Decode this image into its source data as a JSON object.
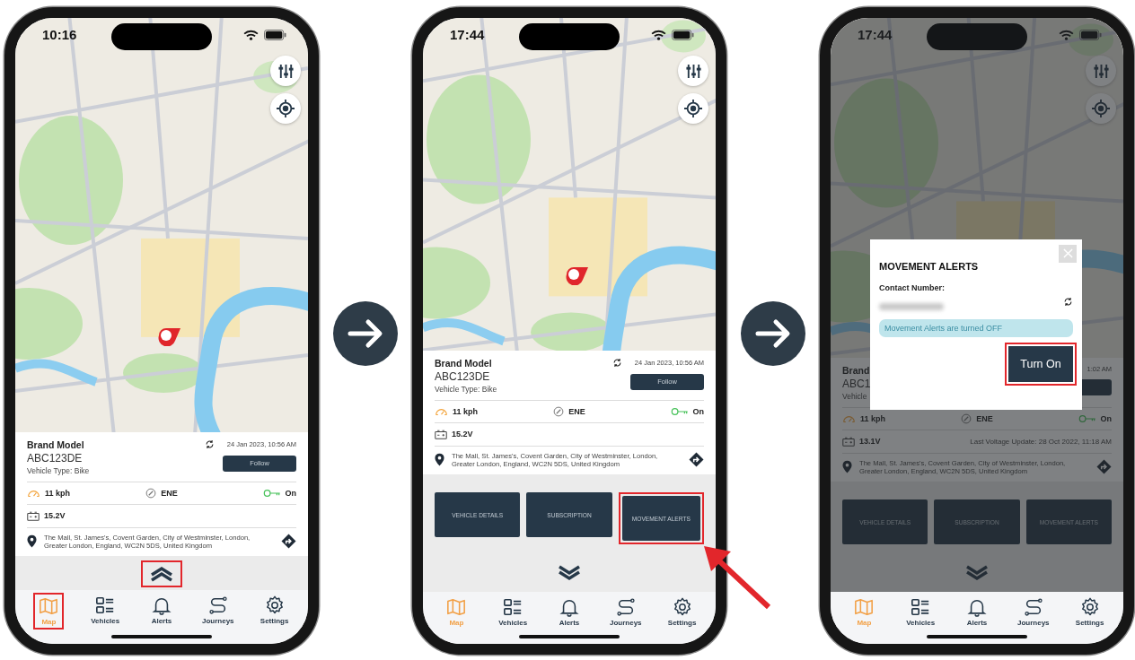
{
  "screens": [
    {
      "status_time": "10:16",
      "dimmed": false,
      "card": {
        "title": "Brand Model",
        "plate": "ABC123DE",
        "vehicle_type": "Vehicle Type: Bike",
        "timestamp": "24 Jan 2023, 10:56 AM",
        "follow_label": "Follow",
        "speed": "11 kph",
        "heading": "ENE",
        "ignition": "On",
        "voltage": "15.2V",
        "address": "The Mall, St. James's, Covent Garden, City of Westminster, London, Greater London, England, WC2N 5DS, United Kingdom"
      },
      "drawer": {
        "expanded": false,
        "highlighted": true
      },
      "tabs": [
        {
          "label": "Map",
          "selected": true,
          "highlighted": true
        },
        {
          "label": "Vehicles",
          "selected": false,
          "highlighted": false
        },
        {
          "label": "Alerts",
          "selected": false,
          "highlighted": false
        },
        {
          "label": "Journeys",
          "selected": false,
          "highlighted": false
        },
        {
          "label": "Settings",
          "selected": false,
          "highlighted": false
        }
      ]
    },
    {
      "status_time": "17:44",
      "dimmed": false,
      "card": {
        "title": "Brand Model",
        "plate": "ABC123DE",
        "vehicle_type": "Vehicle Type: Bike",
        "timestamp": "24 Jan 2023, 10:56 AM",
        "follow_label": "Follow",
        "speed": "11 kph",
        "heading": "ENE",
        "ignition": "On",
        "voltage": "15.2V",
        "address": "The Mall, St. James's, Covent Garden, City of Westminster, London, Greater London, England, WC2N 5DS, United Kingdom"
      },
      "actions": [
        {
          "label": "VEHICLE DETAILS",
          "highlighted": false,
          "pointed": false
        },
        {
          "label": "SUBSCRIPTION",
          "highlighted": false,
          "pointed": false
        },
        {
          "label": "MOVEMENT ALERTS",
          "highlighted": true,
          "pointed": true
        }
      ],
      "drawer": {
        "expanded": true,
        "highlighted": false
      },
      "tabs": [
        {
          "label": "Map",
          "selected": true,
          "highlighted": false
        },
        {
          "label": "Vehicles",
          "selected": false,
          "highlighted": false
        },
        {
          "label": "Alerts",
          "selected": false,
          "highlighted": false
        },
        {
          "label": "Journeys",
          "selected": false,
          "highlighted": false
        },
        {
          "label": "Settings",
          "selected": false,
          "highlighted": false
        }
      ]
    },
    {
      "status_time": "17:44",
      "dimmed": true,
      "card": {
        "title": "Brand",
        "plate": "ABC1",
        "vehicle_type": "Vehicle",
        "timestamp": "1:02 AM",
        "speed": "11 kph",
        "heading": "ENE",
        "ignition": "On",
        "voltage": "13.1V",
        "voltage_update": "Last Voltage Update: 28 Oct 2022, 11:18 AM",
        "address": "The Mall, St. James's, Covent Garden, City of Westminster, London, Greater London, England, WC2N 5DS, United Kingdom"
      },
      "modal": {
        "title": "MOVEMENT ALERTS",
        "contact_label": "Contact Number:",
        "status_message": "Movement Alerts are turned OFF",
        "button_label": "Turn On",
        "button_highlighted": true
      },
      "actions": [
        {
          "label": "VEHICLE DETAILS",
          "highlighted": false,
          "pointed": false
        },
        {
          "label": "SUBSCRIPTION",
          "highlighted": false,
          "pointed": false
        },
        {
          "label": "MOVEMENT ALERTS",
          "highlighted": false,
          "pointed": false
        }
      ],
      "drawer": {
        "expanded": true,
        "highlighted": false
      },
      "tabs": [
        {
          "label": "Map",
          "selected": true,
          "highlighted": false
        },
        {
          "label": "Vehicles",
          "selected": false,
          "highlighted": false
        },
        {
          "label": "Alerts",
          "selected": false,
          "highlighted": false
        },
        {
          "label": "Journeys",
          "selected": false,
          "highlighted": false
        },
        {
          "label": "Settings",
          "selected": false,
          "highlighted": false
        }
      ]
    }
  ]
}
